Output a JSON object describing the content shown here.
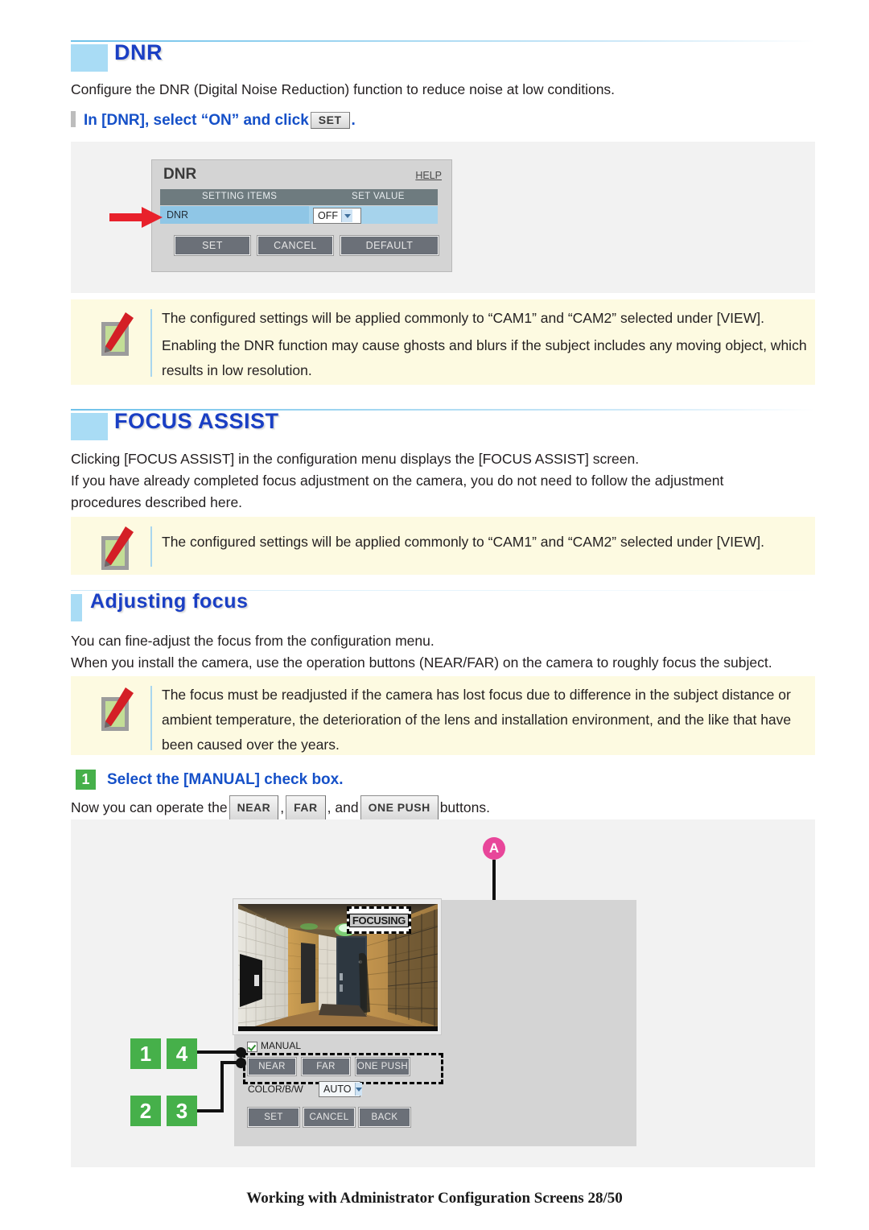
{
  "sections": {
    "dnr": {
      "title": "DNR",
      "intro": "Configure the DNR (Digital Noise Reduction) function to reduce noise at low conditions.",
      "step_heading_pre": "In [DNR], select “ON” and click",
      "step_heading_btn": "SET",
      "step_heading_post": ".",
      "dialog": {
        "title": "DNR",
        "help": "HELP",
        "col_items": "SETTING ITEMS",
        "col_value": "SET VALUE",
        "row_label": "DNR",
        "row_value": "OFF",
        "buttons": [
          "SET",
          "CANCEL",
          "DEFAULT"
        ]
      },
      "notes": [
        "The configured settings will be applied commonly to “CAM1” and “CAM2” selected under [VIEW].",
        "Enabling the DNR function may cause ghosts and blurs if the subject includes any moving object, which results in low resolution."
      ]
    },
    "focus_assist": {
      "title": "FOCUS ASSIST",
      "para1": "Clicking [FOCUS ASSIST] in the configuration menu displays the [FOCUS ASSIST] screen.",
      "para2": "If you have already completed focus adjustment on the camera, you do not need to follow the adjustment procedures described here.",
      "note": "The configured settings will be applied commonly to “CAM1” and “CAM2” selected under [VIEW]."
    },
    "adjusting_focus": {
      "title": "Adjusting focus",
      "para1": "You can fine-adjust the focus from the configuration menu.",
      "para2": "When you install the camera, use the operation buttons (NEAR/FAR) on the camera to roughly focus the subject.",
      "note": "The focus must be readjusted if the camera has lost focus due to difference in the subject distance or ambient temperature, the deterioration of the lens and installation environment, and the like that have been caused over the years.",
      "step_number": "1",
      "step_heading": "Select the [MANUAL] check box.",
      "operate_pre": "Now you can operate the",
      "operate_btn1": "NEAR",
      "operate_sep1": ",",
      "operate_btn2": "FAR",
      "operate_sep2": ", and",
      "operate_btn3": "ONE PUSH",
      "operate_post": "buttons.",
      "screen": {
        "callout_a": "A",
        "focusing_label": "FOCUSING",
        "manual_label": "MANUAL",
        "focus_buttons": [
          "NEAR",
          "FAR",
          "ONE PUSH"
        ],
        "colorbw_label": "COLOR/B/W",
        "colorbw_value": "AUTO",
        "action_buttons": [
          "SET",
          "CANCEL",
          "BACK"
        ],
        "step_badges": [
          "1",
          "4",
          "2",
          "3"
        ]
      }
    }
  },
  "footer": "Working with Administrator Configuration Screens 28/50",
  "colors": {
    "heading_blue": "#1a3fc4",
    "accent_block": "#a9dcf5",
    "step_blue": "#1550c8",
    "note_bg": "#fdfae1",
    "badge_green": "#46b04a",
    "callout_pink": "#e8469a",
    "arrow_red": "#e8212b"
  }
}
